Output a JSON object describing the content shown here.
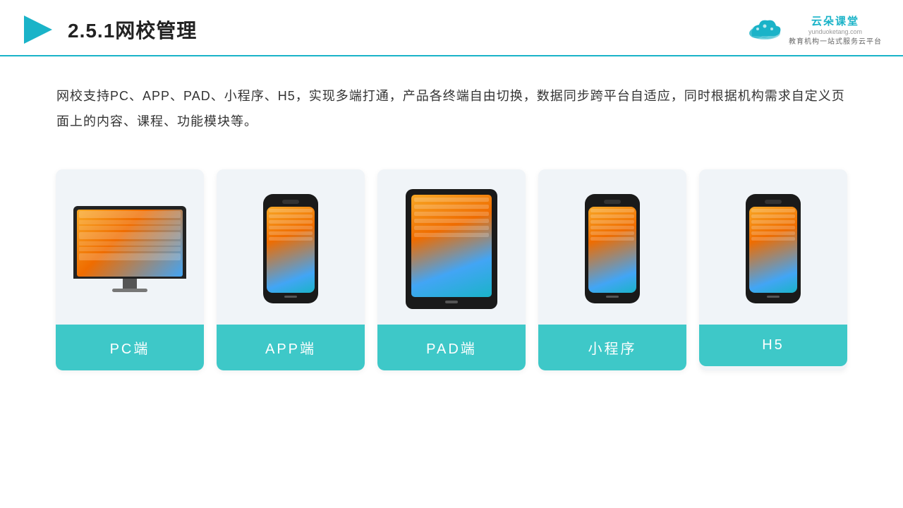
{
  "header": {
    "title": "2.5.1网校管理",
    "logo": {
      "name": "云朵课堂",
      "url": "yunduoketang.com",
      "tagline": "教育机构一站式服务云平台"
    }
  },
  "description": "网校支持PC、APP、PAD、小程序、H5，实现多端打通，产品各终端自由切换，数据同步跨平台自适应，同时根据机构需求自定义页面上的内容、课程、功能模块等。",
  "cards": [
    {
      "id": "pc",
      "label": "PC端",
      "type": "pc"
    },
    {
      "id": "app",
      "label": "APP端",
      "type": "phone"
    },
    {
      "id": "pad",
      "label": "PAD端",
      "type": "tablet"
    },
    {
      "id": "miniprogram",
      "label": "小程序",
      "type": "phone"
    },
    {
      "id": "h5",
      "label": "H5",
      "type": "phone"
    }
  ],
  "colors": {
    "accent": "#1ab3c8",
    "card_bg": "#eef2f7",
    "label_bg": "#3ec8c8",
    "title": "#222222",
    "text": "#333333"
  }
}
